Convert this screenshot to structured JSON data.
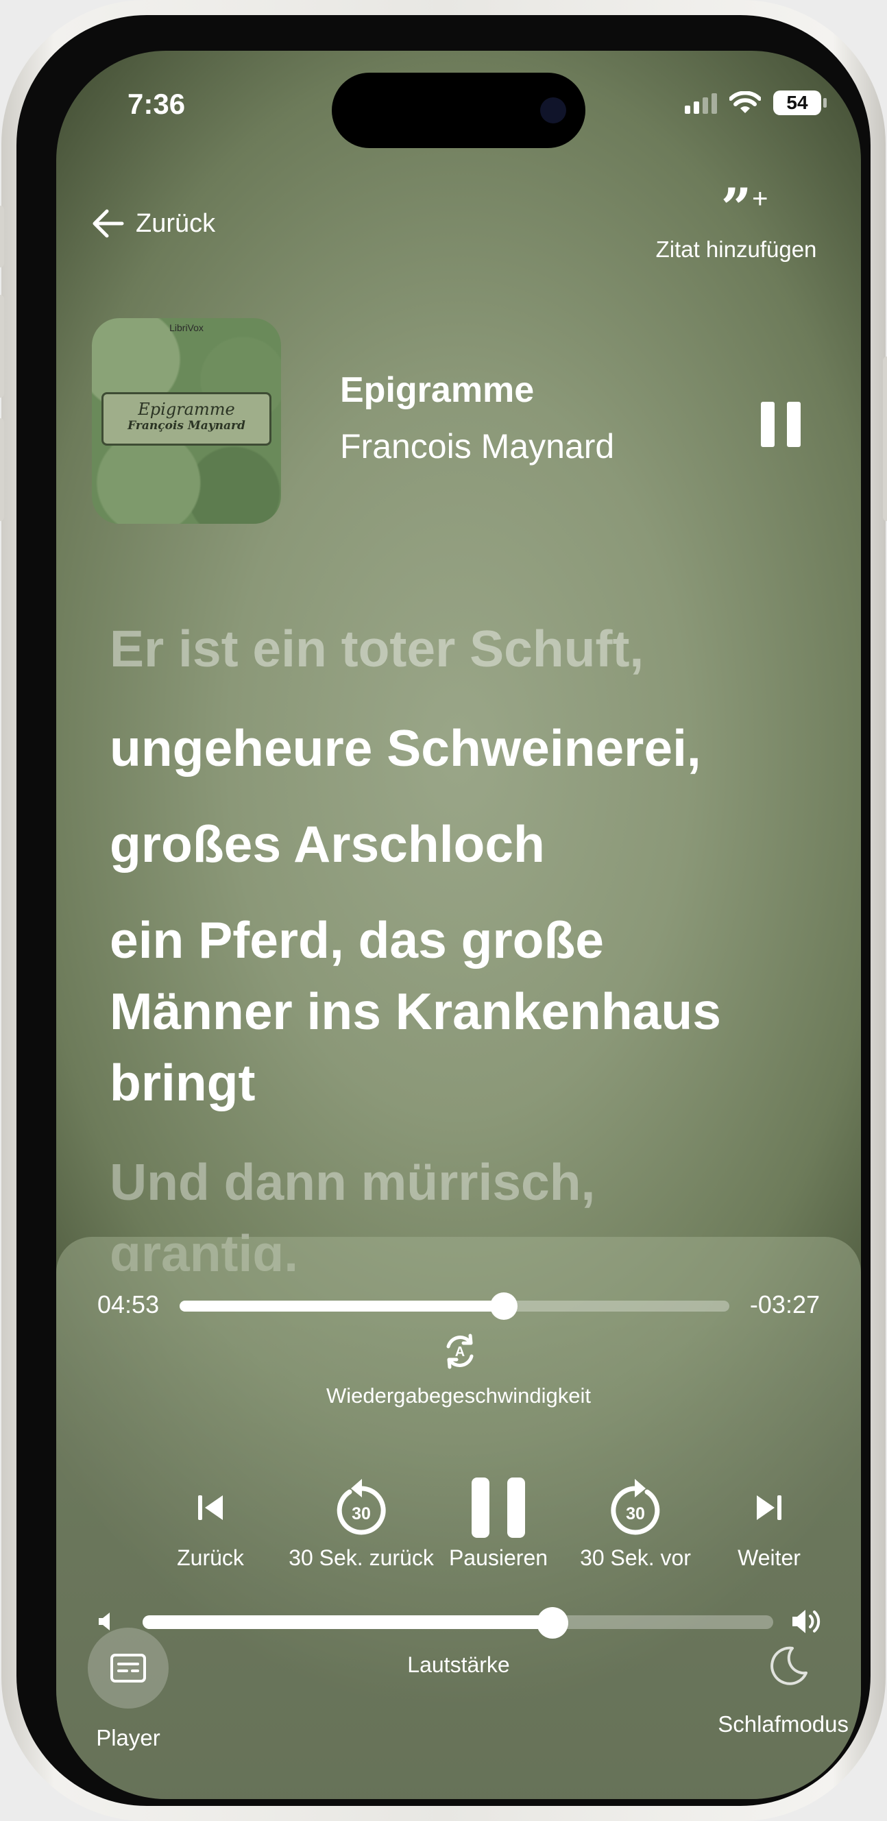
{
  "status_bar": {
    "time": "7:36",
    "battery": "54"
  },
  "header": {
    "back_label": "Zurück",
    "quote_label": "Zitat hinzufügen"
  },
  "cover": {
    "brand": "LibriVox",
    "title": "Epigramme",
    "author": "François Maynard"
  },
  "now_playing": {
    "title": "Epigramme",
    "author": "Francois Maynard"
  },
  "lyrics": [
    {
      "text": "Er ist ein toter Schuft,",
      "state": "past"
    },
    {
      "text": "ungeheure Schweinerei,",
      "state": "current"
    },
    {
      "text": "großes Arschloch",
      "state": "current"
    },
    {
      "text": "ein Pferd, das große",
      "state": "current"
    },
    {
      "text": "Männer ins Krankenhaus",
      "state": "current"
    },
    {
      "text": "bringt",
      "state": "current"
    },
    {
      "text": "Und dann mürrisch,",
      "state": "upcoming"
    },
    {
      "text": "grantig,",
      "state": "upcoming"
    }
  ],
  "playback": {
    "elapsed": "04:53",
    "remaining": "-03:27",
    "progress_fraction": 0.59,
    "speed_label": "Wiedergabegeschwindigkeit",
    "volume_fraction": 0.65,
    "volume_label": "Lautstärke"
  },
  "controls": {
    "previous": "Zurück",
    "skip_back": "30 Sek. zurück",
    "skip_back_seconds": "30",
    "pause": "Pausieren",
    "skip_forward": "30 Sek. vor",
    "skip_forward_seconds": "30",
    "next": "Weiter"
  },
  "footer": {
    "player_label": "Player",
    "sleep_label": "Schlafmodus"
  },
  "colors": {
    "background": "#8b9878",
    "text": "#ffffff"
  }
}
